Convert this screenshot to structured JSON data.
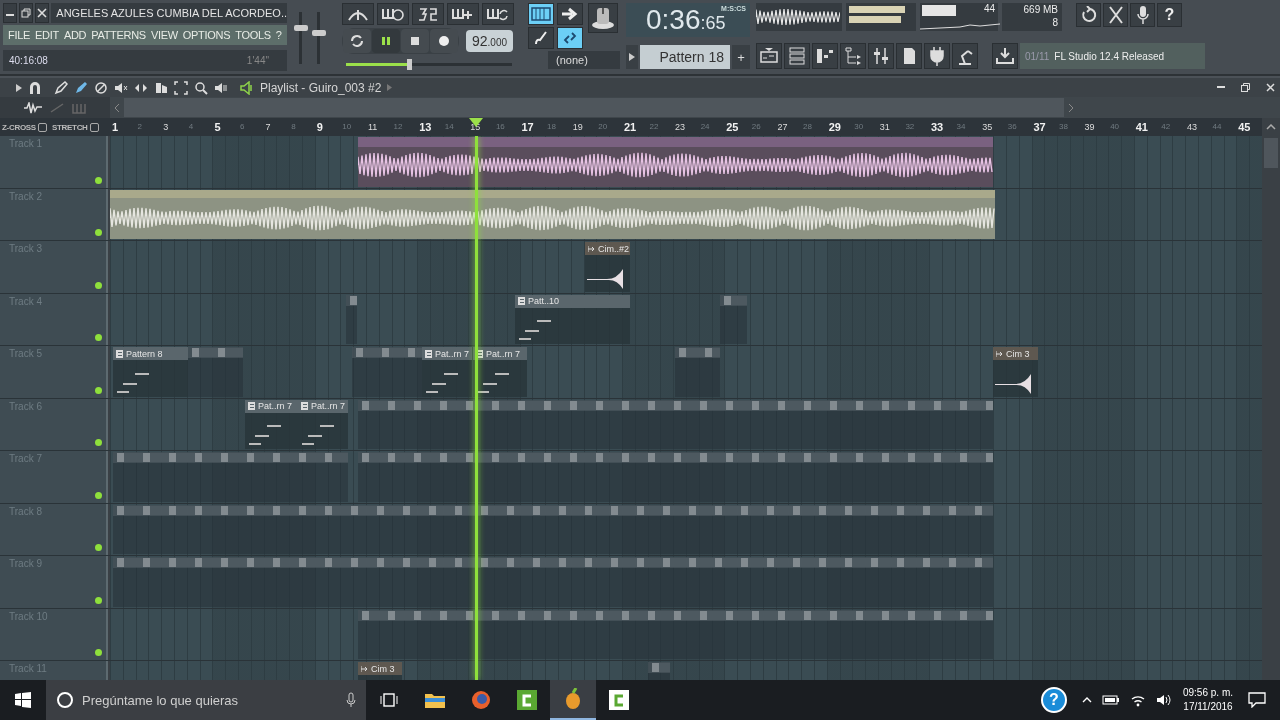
{
  "window": {
    "song_title": "ANGELES AZULES CUMBIA DEL ACORDEO..",
    "menu": [
      "FILE",
      "EDIT",
      "ADD",
      "PATTERNS",
      "VIEW",
      "OPTIONS",
      "TOOLS",
      "?"
    ],
    "hint_left": "40:16:08",
    "hint_right": "1'44\""
  },
  "sliders": {
    "volume": {
      "level": 0.72
    },
    "pitch": {
      "level": 0.6
    },
    "master_pitch": {
      "level": 0.38
    }
  },
  "transport": {
    "playing": true,
    "tempo": "92",
    "tempo_fraction": ".000",
    "snap": "(none)",
    "time": "0:36",
    "time_cs": ":65",
    "time_format": "M:S:CS",
    "pattern": "Pattern 18",
    "add_pattern": "+"
  },
  "monitor": {
    "cpu": "44",
    "memory": "669 MB",
    "polyphony": "8"
  },
  "help_button": "?",
  "news": {
    "counter": "01/11",
    "text": "FL Studio 12.4 Released"
  },
  "playlist": {
    "title": "Playlist - Guiro_003 #2",
    "zcross": {
      "label": "Z-CROSS",
      "checked": false
    },
    "stretch": {
      "label": "STRETCH",
      "checked": false
    },
    "ruler": [
      "1",
      "2",
      "3",
      "4",
      "5",
      "6",
      "7",
      "8",
      "9",
      "10",
      "11",
      "12",
      "13",
      "14",
      "15",
      "16",
      "17",
      "18",
      "19",
      "20",
      "21",
      "22",
      "23",
      "24",
      "25",
      "26",
      "27",
      "28",
      "29",
      "30",
      "31",
      "32",
      "33",
      "34",
      "35",
      "36",
      "37",
      "38",
      "39",
      "40",
      "41",
      "42",
      "43",
      "44",
      "45"
    ],
    "tracks": [
      {
        "name": "Track 1"
      },
      {
        "name": "Track 2"
      },
      {
        "name": "Track 3",
        "clips": [
          {
            "label": "Cim..#2",
            "kind": "audio"
          }
        ]
      },
      {
        "name": "Track 4",
        "clips": [
          {
            "label": "Patt..10",
            "kind": "pattern"
          }
        ]
      },
      {
        "name": "Track 5",
        "clips": [
          {
            "label": "Pattern 8",
            "kind": "pattern"
          },
          {
            "label": "Pat..rn 7",
            "kind": "pattern"
          },
          {
            "label": "Pat..rn 7",
            "kind": "pattern"
          },
          {
            "label": "Cim 3",
            "kind": "audio"
          }
        ]
      },
      {
        "name": "Track 6",
        "clips": [
          {
            "label": "Pat..rn 7",
            "kind": "pattern"
          },
          {
            "label": "Pat..rn 7",
            "kind": "pattern"
          }
        ]
      },
      {
        "name": "Track 7"
      },
      {
        "name": "Track 8"
      },
      {
        "name": "Track 9"
      },
      {
        "name": "Track 10"
      },
      {
        "name": "Track 11",
        "clips": [
          {
            "label": "Cim 3",
            "kind": "audio"
          }
        ]
      }
    ]
  },
  "taskbar": {
    "search_placeholder": "Pregúntame lo que quieras",
    "help": "?",
    "time": "09:56 p. m.",
    "date": "17/11/2016"
  }
}
